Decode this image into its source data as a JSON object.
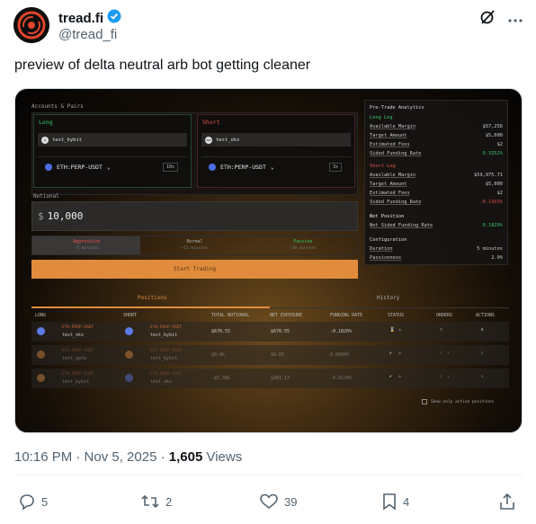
{
  "tweet": {
    "display_name": "tread.fi",
    "handle": "@tread_fi",
    "text": "preview of delta neutral arb bot getting cleaner",
    "time": "10:16 PM · Nov 5, 2025 · ",
    "views_count": "1,605",
    "views_label": " Views",
    "replies": "5",
    "reposts": "2",
    "likes": "39",
    "bookmarks": "4"
  },
  "app": {
    "section_title": "Accounts & Pairs",
    "long": {
      "title": "Long",
      "account": "test_bybit",
      "pair": "ETH:PERP-USDT",
      "leverage": "10x"
    },
    "short": {
      "title": "Short",
      "account": "test_okx",
      "pair": "ETH:PERP-USDT",
      "leverage": "3x"
    },
    "notional_label": "Notional",
    "notional_currency": "$",
    "notional_value": "10,000",
    "modes": [
      {
        "label": "Aggressive",
        "sub": "~5 minutes"
      },
      {
        "label": "Normal",
        "sub": "~15 minutes"
      },
      {
        "label": "Passive",
        "sub": "~30 minutes"
      }
    ],
    "start_button": "Start Trading",
    "analytics": {
      "title": "Pre-Trade Analytics",
      "long_leg_label": "Long Leg",
      "long_leg": [
        {
          "k": "Available Margin",
          "v": "$57,256"
        },
        {
          "k": "Target Amount",
          "v": "$5,000"
        },
        {
          "k": "Estimated Fees",
          "v": "$2"
        },
        {
          "k": "Sided Funding Rate",
          "v": "0.3252%"
        }
      ],
      "short_leg_label": "Short Leg",
      "short_leg": [
        {
          "k": "Available Margin",
          "v": "$59,975.71"
        },
        {
          "k": "Target Amount",
          "v": "$5,000"
        },
        {
          "k": "Estimated Fees",
          "v": "$2"
        },
        {
          "k": "Sided Funding Rate",
          "v": "-0.1433%"
        }
      ],
      "net_position_label": "Net Position",
      "net_row": {
        "k": "Net Sided Funding Rate",
        "v": "0.1820%"
      },
      "config_title": "Configuration",
      "config": [
        {
          "k": "Duration",
          "v": "5 minutes"
        },
        {
          "k": "Passiveness",
          "v": "2.0%"
        }
      ]
    },
    "tabs": [
      "Positions",
      "History"
    ],
    "columns": [
      "LONG",
      "SHORT",
      "TOTAL NOTIONAL",
      "NET EXPOSURE",
      "FUNDING RATE",
      "STATUS",
      "ORDERS",
      "ACTIONS"
    ],
    "rows": [
      {
        "long_pair": "ETH-PERP-USDT",
        "long_acct": "test_okx",
        "short_pair": "ETH-PERP-USDT",
        "short_acct": "test_bybit",
        "total": "$670.55",
        "exposure": "$670.55",
        "funding": "-0.1820%"
      },
      {
        "long_pair": "BTC-PERP-USDT",
        "long_acct": "test_gate",
        "short_pair": "BTC-PERP-USDT",
        "short_acct": "test_bybit",
        "total": "$0.0k",
        "exposure": "$0.03",
        "funding": "0.0084%"
      },
      {
        "long_pair": "ETH-PERP-USDT",
        "long_acct": "test_bybit",
        "short_pair": "ETH-PERP-USDT",
        "short_acct": "test_okx",
        "total": "-$5.30k",
        "exposure": "$301.17",
        "funding": "-0.0129%"
      }
    ],
    "show_active_label": "Show only active positions"
  }
}
